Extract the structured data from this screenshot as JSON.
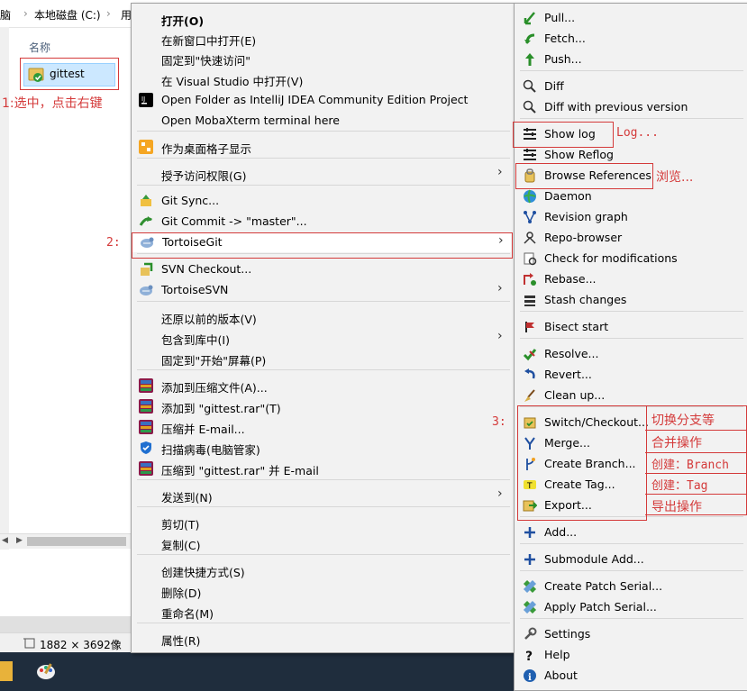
{
  "explorer": {
    "breadcrumb": [
      "脑",
      "本地磁盘 (C:)",
      "用"
    ],
    "column_header": "名称",
    "selected_file": "gittest",
    "status_text": "1882 × 3692像"
  },
  "annotations": {
    "step1": "1:选中，点击右键",
    "step2": "2:",
    "step3": "3:",
    "log": "Log...",
    "browse": "浏览...",
    "switch": "切换分支等",
    "merge": "合并操作",
    "branch": "创建：Branch",
    "tag": "创建：Tag",
    "export": "导出操作"
  },
  "main_menu": [
    {
      "label": "打开(O)",
      "bold": true
    },
    {
      "label": "在新窗口中打开(E)"
    },
    {
      "label": "固定到\"快速访问\""
    },
    {
      "label": "在 Visual Studio 中打开(V)"
    },
    {
      "label": "Open Folder as IntelliJ IDEA Community Edition Project"
    },
    {
      "label": "Open MobaXterm terminal here"
    },
    {
      "label": "作为桌面格子显示"
    },
    {
      "label": "授予访问权限(G)"
    },
    {
      "label": "Git Sync..."
    },
    {
      "label": "Git Commit -> \"master\"..."
    },
    {
      "label": "TortoiseGit"
    },
    {
      "label": "SVN Checkout..."
    },
    {
      "label": "TortoiseSVN"
    },
    {
      "label": "还原以前的版本(V)"
    },
    {
      "label": "包含到库中(I)"
    },
    {
      "label": "固定到\"开始\"屏幕(P)"
    },
    {
      "label": "添加到压缩文件(A)..."
    },
    {
      "label": "添加到 \"gittest.rar\"(T)"
    },
    {
      "label": "压缩并 E-mail..."
    },
    {
      "label": "扫描病毒(电脑管家)"
    },
    {
      "label": "压缩到 \"gittest.rar\" 并 E-mail"
    },
    {
      "label": "发送到(N)"
    },
    {
      "label": "剪切(T)"
    },
    {
      "label": "复制(C)"
    },
    {
      "label": "创建快捷方式(S)"
    },
    {
      "label": "删除(D)"
    },
    {
      "label": "重命名(M)"
    },
    {
      "label": "属性(R)"
    }
  ],
  "git_menu": [
    {
      "label": "Pull..."
    },
    {
      "label": "Fetch..."
    },
    {
      "label": "Push..."
    },
    {
      "label": "Diff"
    },
    {
      "label": "Diff with previous version"
    },
    {
      "label": "Show log"
    },
    {
      "label": "Show Reflog"
    },
    {
      "label": "Browse References"
    },
    {
      "label": "Daemon"
    },
    {
      "label": "Revision graph"
    },
    {
      "label": "Repo-browser"
    },
    {
      "label": "Check for modifications"
    },
    {
      "label": "Rebase..."
    },
    {
      "label": "Stash changes"
    },
    {
      "label": "Bisect start"
    },
    {
      "label": "Resolve..."
    },
    {
      "label": "Revert..."
    },
    {
      "label": "Clean up..."
    },
    {
      "label": "Switch/Checkout..."
    },
    {
      "label": "Merge..."
    },
    {
      "label": "Create Branch..."
    },
    {
      "label": "Create Tag..."
    },
    {
      "label": "Export..."
    },
    {
      "label": "Add..."
    },
    {
      "label": "Submodule Add..."
    },
    {
      "label": "Create Patch Serial..."
    },
    {
      "label": "Apply Patch Serial..."
    },
    {
      "label": "Settings"
    },
    {
      "label": "Help"
    },
    {
      "label": "About"
    }
  ]
}
